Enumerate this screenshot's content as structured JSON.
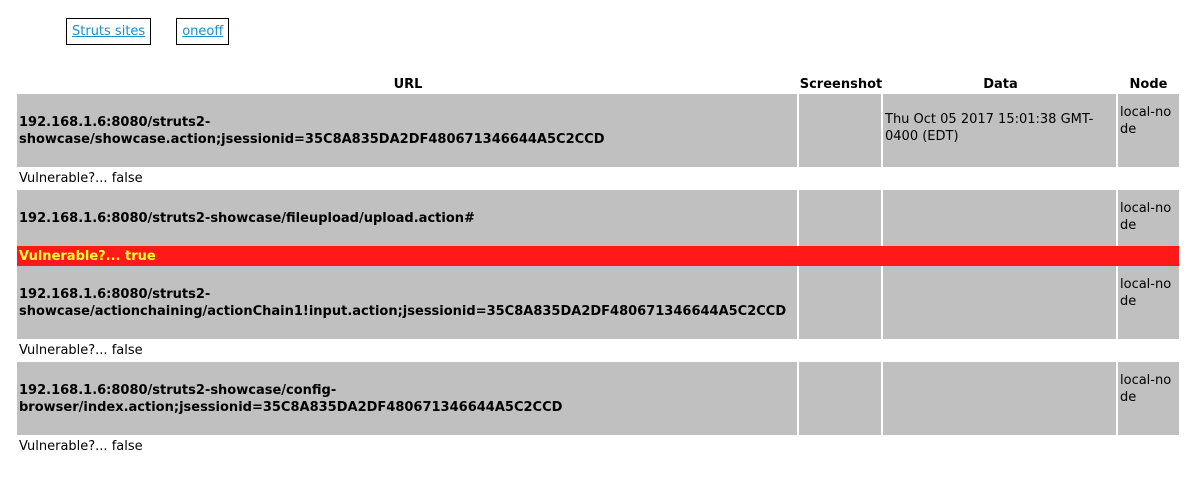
{
  "nav": {
    "links": [
      {
        "label": "Struts sites"
      },
      {
        "label": "oneoff"
      }
    ]
  },
  "table": {
    "headers": {
      "url": "URL",
      "screenshot": "Screenshot",
      "data": "Data",
      "node": "Node"
    },
    "rows": [
      {
        "url": "192.168.1.6:8080/struts2-showcase/showcase.action;jsessionid=35C8A835DA2DF480671346644A5C2CCD",
        "screenshot": "",
        "date": "Thu Oct 05 2017 15:01:38 GMT-0400 (EDT)",
        "node": "local-node",
        "vulnerable": "Vulnerable?... false"
      },
      {
        "url": "192.168.1.6:8080/struts2-showcase/fileupload/upload.action#",
        "screenshot": "",
        "date": "",
        "node": "local-node",
        "vulnerable": "Vulnerable?... true"
      },
      {
        "url": "192.168.1.6:8080/struts2-showcase/actionchaining/actionChain1!input.action;jsessionid=35C8A835DA2DF480671346644A5C2CCD",
        "screenshot": "",
        "date": "",
        "node": "local-node",
        "vulnerable": "Vulnerable?... false"
      },
      {
        "url": "192.168.1.6:8080/struts2-showcase/config-browser/index.action;jsessionid=35C8A835DA2DF480671346644A5C2CCD",
        "screenshot": "",
        "date": "",
        "node": "local-node",
        "vulnerable": "Vulnerable?... false"
      }
    ]
  },
  "colors": {
    "row_bg": "#c0c0c0",
    "vulnerable_bg": "#ff1919",
    "vulnerable_text": "#ffff33",
    "link": "#1a8fd0"
  }
}
